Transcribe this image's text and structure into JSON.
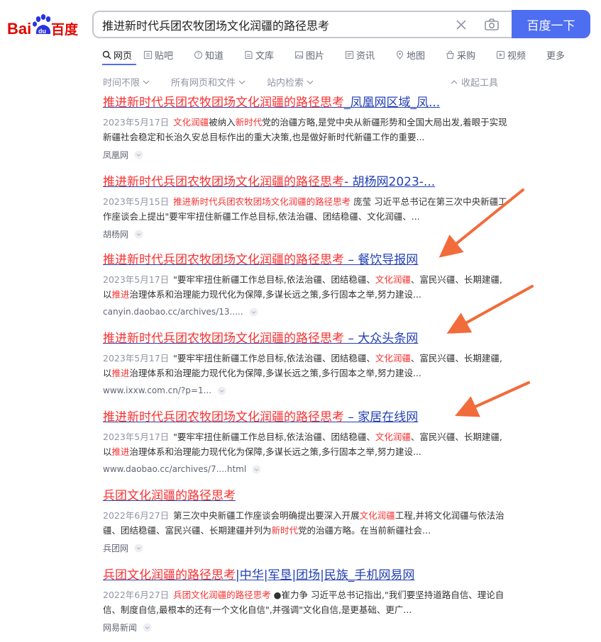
{
  "header": {
    "search_value": "推进新时代兵团农牧团场文化润疆的路径思考",
    "search_button": "百度一下",
    "brand_colors": {
      "red": "#e10602",
      "blue": "#2932e1",
      "accent": "#4e6ef2"
    }
  },
  "tabs": [
    {
      "label": "网页",
      "icon": "search-icon"
    },
    {
      "label": "贴吧",
      "icon": "tieba-icon"
    },
    {
      "label": "知道",
      "icon": "zhidao-icon"
    },
    {
      "label": "文库",
      "icon": "wenku-icon"
    },
    {
      "label": "图片",
      "icon": "image-icon"
    },
    {
      "label": "资讯",
      "icon": "news-icon"
    },
    {
      "label": "地图",
      "icon": "map-icon"
    },
    {
      "label": "采购",
      "icon": "shopping-icon"
    },
    {
      "label": "视频",
      "icon": "video-icon"
    },
    {
      "label": "更多"
    }
  ],
  "filters": {
    "time": "时间不限",
    "files": "所有网页和文件",
    "site": "站内检索",
    "collapse": "收起工具"
  },
  "results": [
    {
      "title_em": "推进新时代兵团农牧团场文化润疆的路径思考",
      "title_rest": "_凤凰网区域_凤...",
      "date": "2023年5月17日",
      "abstract_parts": [
        {
          "t": "文化润疆",
          "hl": true
        },
        {
          "t": "被纳入",
          "hl": false
        },
        {
          "t": "新时代",
          "hl": true
        },
        {
          "t": "党的治疆方略,是党中央从新疆形势和全国大局出发,着眼于实现新疆社会稳定和长治久安总目标作出的重大决策,也是做好新时代新疆工作的重要...",
          "hl": false
        }
      ],
      "source": "凤凰网"
    },
    {
      "title_em": "推进新时代兵团农牧团场文化润疆的路径思考",
      "title_rest": "- 胡杨网2023-...",
      "date": "2023年5月15日",
      "abstract_parts": [
        {
          "t": "推进新时代兵团农牧团场文化润疆的路径思考",
          "hl": true
        },
        {
          "t": " 庞莹 习近平总书记在第三次中央新疆工作座谈会上提出\"要牢牢扭住新疆工作总目标,依法治疆、团结稳疆、文化润疆、...",
          "hl": false
        }
      ],
      "source": "胡杨网"
    },
    {
      "title_em": "推进新时代兵团农牧团场文化润疆的路径思考",
      "title_rest": " – 餐饮导报网",
      "date": "2023年5月17日",
      "abstract_parts": [
        {
          "t": "\"要牢牢扭住新疆工作总目标,依法治疆、团结稳疆、",
          "hl": false
        },
        {
          "t": "文化润疆",
          "hl": true
        },
        {
          "t": "、富民兴疆、长期建疆,以",
          "hl": false
        },
        {
          "t": "推进",
          "hl": true
        },
        {
          "t": "治理体系和治理能力现代化为保障,多谋长远之策,多行固本之举,努力建设...",
          "hl": false
        }
      ],
      "source": "canyin.daobao.cc/archives/13....."
    },
    {
      "title_em": "推进新时代兵团农牧团场文化润疆的路径思考",
      "title_rest": " – 大众头条网",
      "date": "2023年5月17日",
      "abstract_parts": [
        {
          "t": "\"要牢牢扭住新疆工作总目标,依法治疆、团结稳疆、",
          "hl": false
        },
        {
          "t": "文化润疆",
          "hl": true
        },
        {
          "t": "、富民兴疆、长期建疆,以",
          "hl": false
        },
        {
          "t": "推进",
          "hl": true
        },
        {
          "t": "治理体系和治理能力现代化为保障,多谋长远之策,多行固本之举,努力建设...",
          "hl": false
        }
      ],
      "source": "www.ixxw.com.cn/?p=1..."
    },
    {
      "title_em": "推进新时代兵团农牧团场文化润疆的路径思考",
      "title_rest": " – 家居在线网",
      "date": "2023年5月17日",
      "abstract_parts": [
        {
          "t": "\"要牢牢扭住新疆工作总目标,依法治疆、团结稳疆、",
          "hl": false
        },
        {
          "t": "文化润疆",
          "hl": true
        },
        {
          "t": "、富民兴疆、长期建疆,以",
          "hl": false
        },
        {
          "t": "推进",
          "hl": true
        },
        {
          "t": "治理体系和治理能力现代化为保障,多谋长远之策,多行固本之举,努力建设...",
          "hl": false
        }
      ],
      "source": "www.daobao.cc/archives/7....html"
    },
    {
      "title_em": "兵团文化润疆的路径思考",
      "title_rest": "",
      "date": "2022年6月27日",
      "abstract_parts": [
        {
          "t": "第三次中央新疆工作座谈会明确提出要深入开展",
          "hl": false
        },
        {
          "t": "文化润疆",
          "hl": true
        },
        {
          "t": "工程,并将文化润疆与依法治疆、团结稳疆、富民兴疆、长期建疆并列为",
          "hl": false
        },
        {
          "t": "新时代",
          "hl": true
        },
        {
          "t": "党的治疆方略。在当前新疆社会...",
          "hl": false
        }
      ],
      "source": "兵团网"
    },
    {
      "title_em": "兵团文化润疆的路径思考",
      "title_rest": "|中华|军垦|团场|民族_手机网易网",
      "date": "2022年6月27日",
      "abstract_parts": [
        {
          "t": "兵团文化润疆的路径思考",
          "hl": true
        },
        {
          "t": " ●崔力争 习近平总书记指出,\"我们要坚持道路自信、理论自信、制度自信,最根本的还有一个文化自信\",并强调\"文化自信,是更基础、更广...",
          "hl": false
        }
      ],
      "source": "网易新闻"
    }
  ],
  "annotation_color": "#f26b3a"
}
